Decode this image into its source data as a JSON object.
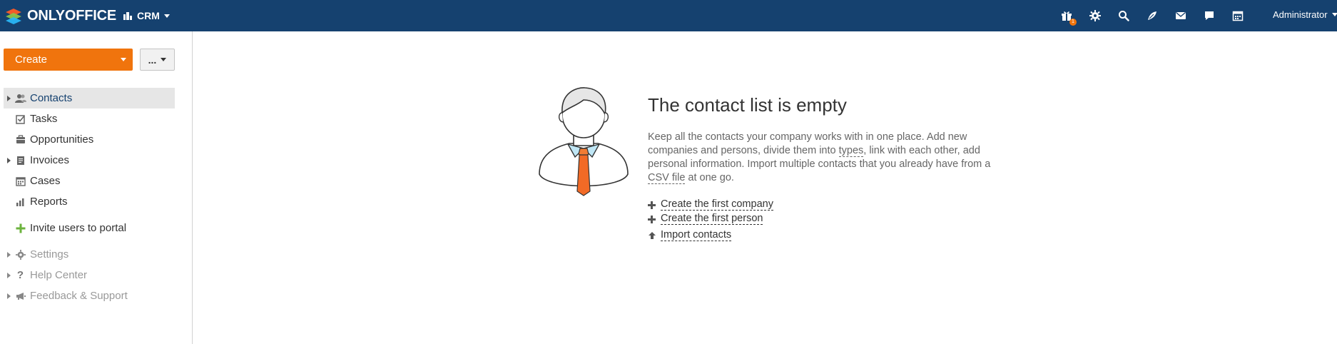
{
  "topbar": {
    "logo_text": "ONLYOFFICE",
    "module_label": "CRM",
    "user_name": "Administrator",
    "gift_badge": "1",
    "icons": [
      "gift-icon",
      "settings-icon",
      "search-icon",
      "feed-icon",
      "mail-icon",
      "talk-icon",
      "calendar-icon"
    ]
  },
  "sidebar": {
    "create_label": "Create",
    "more_label": "...",
    "items": [
      {
        "label": "Contacts",
        "icon": "contacts-icon",
        "expandable": true,
        "active": true
      },
      {
        "label": "Tasks",
        "icon": "tasks-icon",
        "expandable": false
      },
      {
        "label": "Opportunities",
        "icon": "opportunities-icon",
        "expandable": false
      },
      {
        "label": "Invoices",
        "icon": "invoices-icon",
        "expandable": true
      },
      {
        "label": "Cases",
        "icon": "cases-icon",
        "expandable": false
      },
      {
        "label": "Reports",
        "icon": "reports-icon",
        "expandable": false
      }
    ],
    "invite_label": "Invite users to portal",
    "bottom_items": [
      {
        "label": "Settings",
        "icon": "gear-icon"
      },
      {
        "label": "Help Center",
        "icon": "question-icon"
      },
      {
        "label": "Feedback & Support",
        "icon": "megaphone-icon"
      }
    ]
  },
  "main": {
    "title": "The contact list is empty",
    "description": {
      "part1": "Keep all the contacts your company works with in one place. Add new companies and persons, divide them into ",
      "link_types": "types",
      "part2": ", link with each other, add personal information. Import multiple contacts that you already have from a ",
      "link_csv": "CSV file",
      "part3": " at one go."
    },
    "actions": {
      "create_company": "Create the first company",
      "create_person": "Create the first person",
      "import_contacts": "Import contacts"
    }
  },
  "colors": {
    "topbar": "#15416f",
    "accent": "#f0740d",
    "invite_plus": "#6cb33e"
  }
}
